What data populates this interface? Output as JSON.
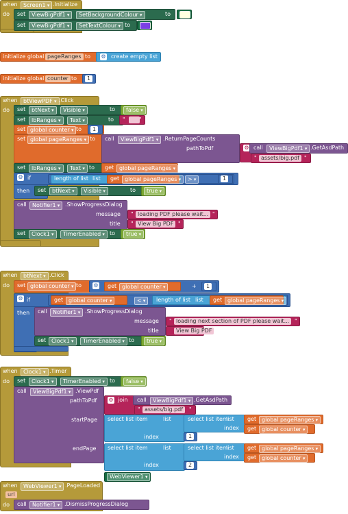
{
  "kw": {
    "when": "when",
    "do": "do",
    "set": "set",
    "to": "to",
    "call": "call",
    "get": "get",
    "if": "if",
    "then": "then",
    "init": "initialize global",
    "join": "join",
    "length": "length of list",
    "list": "list",
    "select": "select list item",
    "index": "index",
    "empty": "create empty list",
    "q": "\""
  },
  "colors": {
    "bg": "#FFFFE0",
    "text": "#7B3FE4"
  },
  "ev1": {
    "comp": "Screen1",
    "ev": ".Initialize",
    "c1": "ViewBigPdf1",
    "p1": "SetBackgroundColour",
    "c2": "ViewBigPdf1",
    "p2": "SetTextColour"
  },
  "g1": {
    "name": "pageRanges"
  },
  "g2": {
    "name": "counter",
    "val": "1"
  },
  "ev2": {
    "comp": "btViewPDF",
    "ev": ".Click",
    "c1": "btNext",
    "p1": "Visible",
    "v1": "false",
    "c2": "lbRanges",
    "p2": "Text",
    "v2": "",
    "v3": "global counter",
    "v3n": "1",
    "v4": "global pageRanges",
    "m4c": "ViewBigPdf1",
    "m4": ".ReturnPageCounts",
    "a4": "pathToPdf",
    "m5c": "ViewBigPdf1",
    "m5": ".GetAsdPath",
    "s5": "assets/big.pdf",
    "c6": "lbRanges",
    "p6": "Text",
    "g6": "global pageRanges",
    "g7": "global pageRanges",
    "op7": ">",
    "n7": "1",
    "c8": "btNext",
    "p8": "Visible",
    "v8": "true",
    "m9c": "Notifier1",
    "m9": ".ShowProgressDialog",
    "a9a": "message",
    "s9a": "loading PDF please wait...",
    "a9b": "title",
    "s9b": "View Big PDF",
    "c10": "Clock1",
    "p10": "TimerEnabled",
    "v10": "true"
  },
  "ev3": {
    "comp": "btNext",
    "ev": ".Click",
    "v1": "global counter",
    "g1": "global counter",
    "op1": "+",
    "n1": "1",
    "g2": "global counter",
    "op2": "<",
    "g3": "global pageRanges",
    "m4c": "Notifier1",
    "m4": ".ShowProgressDialog",
    "a4a": "message",
    "s4a": "loading next section of PDF please wait...",
    "a4b": "title",
    "s4b": "View Big PDF",
    "c5": "Clock1",
    "p5": "TimerEnabled",
    "v5": "true"
  },
  "ev4": {
    "comp": "Clock1",
    "ev": ".Timer",
    "c1": "Clock1",
    "p1": "TimerEnabled",
    "v1": "false",
    "m2c": "ViewBigPdf1",
    "m2": ".ViewPdf",
    "a2a": "pathToPdf",
    "m3c": "ViewBigPdf1",
    "m3": ".GetAsdPath",
    "s3": "assets/big.pdf",
    "a2b": "startPage",
    "g4": "global pageRanges",
    "g5": "global counter",
    "n6": "1",
    "a2c": "endPage",
    "g7": "global pageRanges",
    "g8": "global counter",
    "n9": "2",
    "a2d": "webViewer",
    "w": "WebViewer1"
  },
  "ev5": {
    "comp": "WebViewer1",
    "ev": ".PageLoaded",
    "param": "url",
    "m1c": "Notifier1",
    "m1": ".DismissProgressDialog"
  }
}
